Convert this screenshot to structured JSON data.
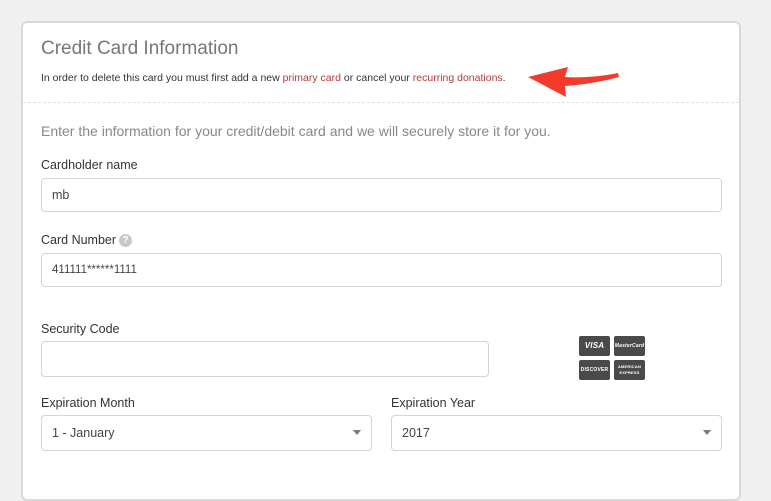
{
  "header": {
    "title": "Credit Card Information",
    "notice_prefix": "In order to delete this card you must first add a new ",
    "primary_card_link": "primary card",
    "notice_middle": " or cancel your ",
    "recurring_link": "recurring donations",
    "notice_suffix": "."
  },
  "form": {
    "intro": "Enter the information for your credit/debit card and we will securely store it for you.",
    "cardholder_label": "Cardholder name",
    "cardholder_value": "mb",
    "card_number_label": "Card Number",
    "card_number_help": "?",
    "card_number_value": "411111******1111",
    "security_code_label": "Security Code",
    "security_code_value": "",
    "exp_month_label": "Expiration Month",
    "exp_month_value": "1 - January",
    "exp_year_label": "Expiration Year",
    "exp_year_value": "2017"
  },
  "card_logos": {
    "visa": "VISA",
    "mastercard": "MasterCard",
    "discover": "DISCOVER",
    "amex": "AMERICAN EXPRESS"
  },
  "colors": {
    "link": "#b33a3a",
    "arrow": "#f23b2a"
  }
}
